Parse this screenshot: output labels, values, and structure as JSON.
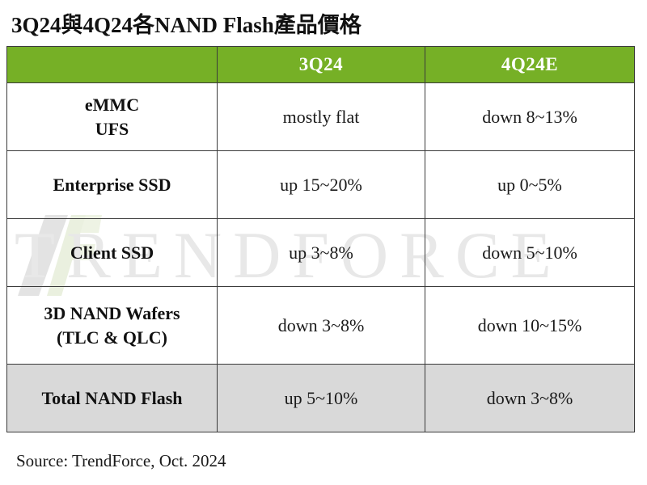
{
  "title": "3Q24與4Q24各NAND Flash產品價格",
  "watermark": {
    "text": "TRENDFORCE",
    "logo_name": "trendforce-logo",
    "color": "#e8e8e8"
  },
  "colors": {
    "header_green": "#76b026",
    "total_row_gray": "#d9d9d9",
    "border": "#3a3a3a",
    "header_text": "#ffffff"
  },
  "table": {
    "columns": [
      {
        "key": "product",
        "label": ""
      },
      {
        "key": "q3",
        "label": "3Q24"
      },
      {
        "key": "q4",
        "label": "4Q24E"
      }
    ],
    "rows": [
      {
        "product_line1": "eMMC",
        "product_line2": "UFS",
        "q3": "mostly flat",
        "q4": "down 8~13%",
        "highlight": false
      },
      {
        "product_line1": "Enterprise SSD",
        "product_line2": "",
        "q3": "up 15~20%",
        "q4": "up 0~5%",
        "highlight": false
      },
      {
        "product_line1": "Client SSD",
        "product_line2": "",
        "q3": "up 3~8%",
        "q4": "down 5~10%",
        "highlight": false
      },
      {
        "product_line1": "3D NAND Wafers",
        "product_line2": "(TLC & QLC)",
        "q3": "down 3~8%",
        "q4": "down 10~15%",
        "highlight": false
      },
      {
        "product_line1": "Total NAND Flash",
        "product_line2": "",
        "q3": "up 5~10%",
        "q4": "down 3~8%",
        "highlight": true
      }
    ]
  },
  "source": "Source: TrendForce, Oct. 2024"
}
